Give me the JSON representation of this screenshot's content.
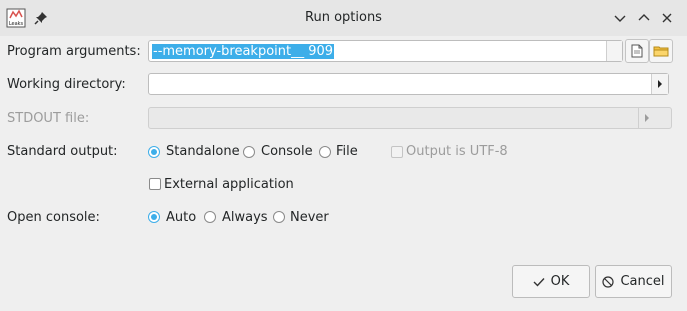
{
  "window": {
    "title": "Run options",
    "app_icon_text": "Leaks"
  },
  "form": {
    "program_arguments": {
      "label": "Program arguments:",
      "value": "--memory-breakpoint__ 909"
    },
    "working_directory": {
      "label": "Working directory:",
      "value": ""
    },
    "stdout_file": {
      "label": "STDOUT file:",
      "value": ""
    },
    "standard_output": {
      "label": "Standard output:",
      "options": [
        "Standalone",
        "Console",
        "File"
      ],
      "selected": "Standalone",
      "utf8_label": "Output is UTF-8",
      "utf8_checked": false
    },
    "external_application": {
      "label": "External application",
      "checked": false
    },
    "open_console": {
      "label": "Open console:",
      "options": [
        "Auto",
        "Always",
        "Never"
      ],
      "selected": "Auto"
    }
  },
  "buttons": {
    "ok": "OK",
    "cancel": "Cancel"
  },
  "colors": {
    "accent": "#3daee9",
    "background": "#efefef",
    "titlebar": "#e6e6e6"
  }
}
